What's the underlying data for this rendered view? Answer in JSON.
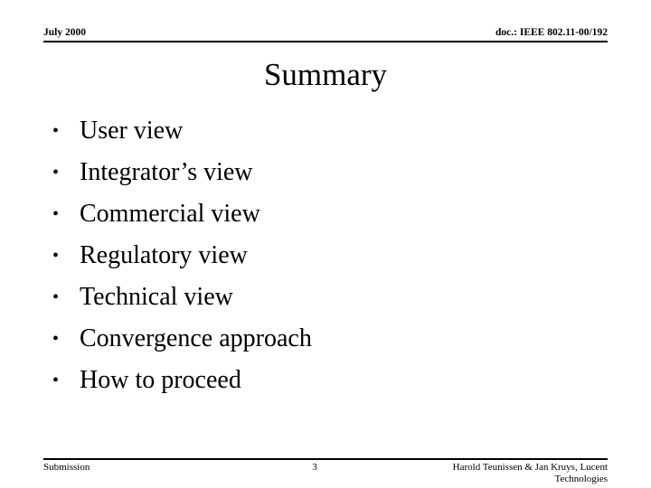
{
  "slide": {
    "header": {
      "left": "July 2000",
      "right": "doc.: IEEE 802.11-00/192"
    },
    "title": "Summary",
    "bullets": [
      {
        "marker": "•",
        "text": "User view"
      },
      {
        "marker": "•",
        "text": "Integrator’s view"
      },
      {
        "marker": "•",
        "text": "Commercial view"
      },
      {
        "marker": "•",
        "text": "Regulatory view"
      },
      {
        "marker": "•",
        "text": "Technical view"
      },
      {
        "marker": "•",
        "text": "Convergence approach"
      },
      {
        "marker": "•",
        "text": "How to proceed"
      }
    ],
    "footer": {
      "left": "Submission",
      "page_number": "3",
      "right": "Harold Teunissen & Jan Kruys, Lucent Technologies"
    },
    "colors": {
      "background": "#ffffff",
      "text": "#000000",
      "rule": "#000000"
    }
  }
}
